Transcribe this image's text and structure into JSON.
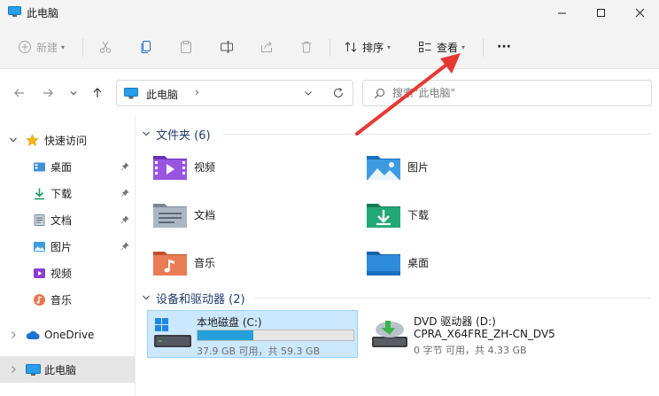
{
  "window": {
    "title": "此电脑"
  },
  "toolbar": {
    "new_label": "新建",
    "sort_label": "排序",
    "view_label": "查看",
    "more_label": "···"
  },
  "address": {
    "crumb": "此电脑",
    "chevron": "›"
  },
  "search": {
    "placeholder": "搜索\"此电脑\""
  },
  "sidebar": {
    "quick_access": "快速访问",
    "items": [
      {
        "label": "桌面",
        "icon": "desktop-icon"
      },
      {
        "label": "下载",
        "icon": "download-icon"
      },
      {
        "label": "文档",
        "icon": "documents-icon"
      },
      {
        "label": "图片",
        "icon": "pictures-icon"
      },
      {
        "label": "视频",
        "icon": "videos-icon"
      },
      {
        "label": "音乐",
        "icon": "music-icon"
      }
    ],
    "onedrive": "OneDrive",
    "this_pc": "此电脑"
  },
  "folders": {
    "header": "文件夹 (6)",
    "items": [
      {
        "label": "视频",
        "icon": "videos-folder-icon"
      },
      {
        "label": "图片",
        "icon": "pictures-folder-icon"
      },
      {
        "label": "文档",
        "icon": "documents-folder-icon"
      },
      {
        "label": "下载",
        "icon": "downloads-folder-icon"
      },
      {
        "label": "音乐",
        "icon": "music-folder-icon"
      },
      {
        "label": "桌面",
        "icon": "desktop-folder-icon"
      }
    ]
  },
  "drives": {
    "header": "设备和驱动器 (2)",
    "items": [
      {
        "name": "本地磁盘 (C:)",
        "space": "37.9 GB 可用，共 59.3 GB",
        "used_fraction": 0.36,
        "icon": "windows-drive-icon"
      },
      {
        "name": "DVD 驱动器 (D:)",
        "label": "CPRA_X64FRE_ZH-CN_DV5",
        "space": "0 字节 可用，共 4.33 GB",
        "icon": "dvd-drive-icon"
      }
    ]
  },
  "colors": {
    "accent": "#0067c0",
    "selection": "#cce8ff",
    "progress": "#26a0da",
    "annotation_arrow": "#e53935"
  }
}
